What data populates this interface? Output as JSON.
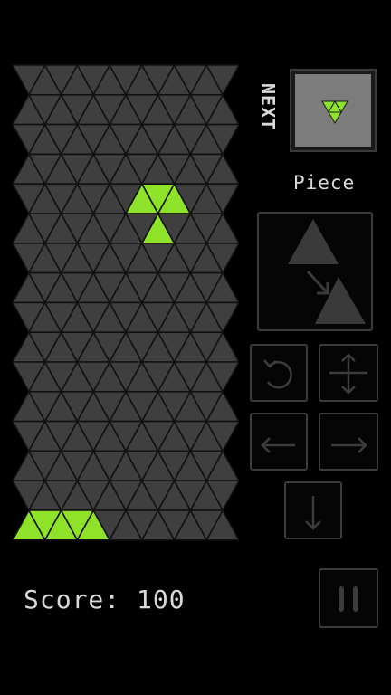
{
  "sidebar": {
    "next_label": "NEXT",
    "piece_label": "Piece"
  },
  "score": {
    "text": "Score: 100"
  },
  "colors": {
    "background": "#000000",
    "cell_empty": "#3f3f3f",
    "cell_filled": "#8ee32a",
    "preview_panel_bg": "#7c7c7c",
    "preview_triangle": "#3a3a3a"
  },
  "board": {
    "rows": 16,
    "triangles_per_row": 13,
    "filled_cells": [
      {
        "row": 4,
        "col": 7
      },
      {
        "row": 4,
        "col": 8
      },
      {
        "row": 4,
        "col": 9
      },
      {
        "row": 5,
        "col": 8
      },
      {
        "row": 15,
        "col": 0
      },
      {
        "row": 15,
        "col": 1
      },
      {
        "row": 15,
        "col": 2
      },
      {
        "row": 15,
        "col": 3
      },
      {
        "row": 15,
        "col": 4
      }
    ]
  },
  "controls": {
    "rotate": "rotate-icon",
    "flip": "vertical-flip-icon",
    "left": "arrow-left-icon",
    "right": "arrow-right-icon",
    "drop": "arrow-down-icon",
    "pause": "pause-icon"
  }
}
